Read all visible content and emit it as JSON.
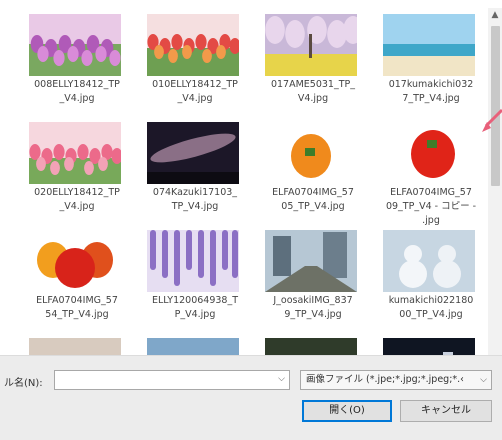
{
  "files": [
    {
      "name": "008ELLY18412_TP_V4.jpg",
      "line1": "008ELLY18412_TP",
      "line2": "_V4.jpg",
      "thumb": "tulip-purple"
    },
    {
      "name": "010ELLY18412_TP_V4.jpg",
      "line1": "010ELLY18412_TP",
      "line2": "_V4.jpg",
      "thumb": "tulip-red"
    },
    {
      "name": "017AME5031_TP_V4.jpg",
      "line1": "017AME5031_TP_",
      "line2": "V4.jpg",
      "thumb": "cherry-blossom"
    },
    {
      "name": "017kumakichi0327_TP_V4.jpg",
      "line1": "017kumakichi032",
      "line2": "7_TP_V4.jpg",
      "thumb": "beach"
    },
    {
      "name": "020ELLY18412_TP_V4.jpg",
      "line1": "020ELLY18412_TP",
      "line2": "_V4.jpg",
      "thumb": "tulip-pink"
    },
    {
      "name": "074Kazuki17103_TP_V4.jpg",
      "line1": "074Kazuki17103_",
      "line2": "TP_V4.jpg",
      "thumb": "milky-way"
    },
    {
      "name": "ELFA0704IMG_5705_TP_V4.jpg",
      "line1": "ELFA0704IMG_57",
      "line2": "05_TP_V4.jpg",
      "thumb": "pepper-orange"
    },
    {
      "name": "ELFA0704IMG_5709_TP_V4 - コピー.jpg",
      "line1": "ELFA0704IMG_57",
      "line2": "09_TP_V4 - コピー -",
      "line3": ".jpg",
      "thumb": "pepper-red"
    },
    {
      "name": "ELFA0704IMG_5754_TP_V4.jpg",
      "line1": "ELFA0704IMG_57",
      "line2": "54_TP_V4.jpg",
      "thumb": "peppers"
    },
    {
      "name": "ELLY120064938_TP_V4.jpg",
      "line1": "ELLY120064938_T",
      "line2": "P_V4.jpg",
      "thumb": "wisteria"
    },
    {
      "name": "J_oosakiIMG_8379_TP_V4.jpg",
      "line1": "J_oosakiIMG_837",
      "line2": "9_TP_V4.jpg",
      "thumb": "railway"
    },
    {
      "name": "kumakichi02218000_TP_V4.jpg",
      "line1": "kumakichi022180",
      "line2": "00_TP_V4.jpg",
      "thumb": "snowmen"
    },
    {
      "name": "",
      "line1": "",
      "line2": "",
      "thumb": "cat"
    },
    {
      "name": "",
      "line1": "",
      "line2": "",
      "thumb": "train"
    },
    {
      "name": "",
      "line1": "",
      "line2": "",
      "thumb": "dark-forest"
    },
    {
      "name": "",
      "line1": "",
      "line2": "",
      "thumb": "night-city"
    }
  ],
  "footer": {
    "filename_label": "ル名(N):",
    "filename_value": "",
    "filetype_label": "画像ファイル (*.jpe;*.jpg;*.jpeg;*.‹",
    "open_label": "開く(O)",
    "cancel_label": "キャンセル"
  },
  "colors": {
    "accent": "#0078d7",
    "annotation_arrow": "#e8607a"
  }
}
